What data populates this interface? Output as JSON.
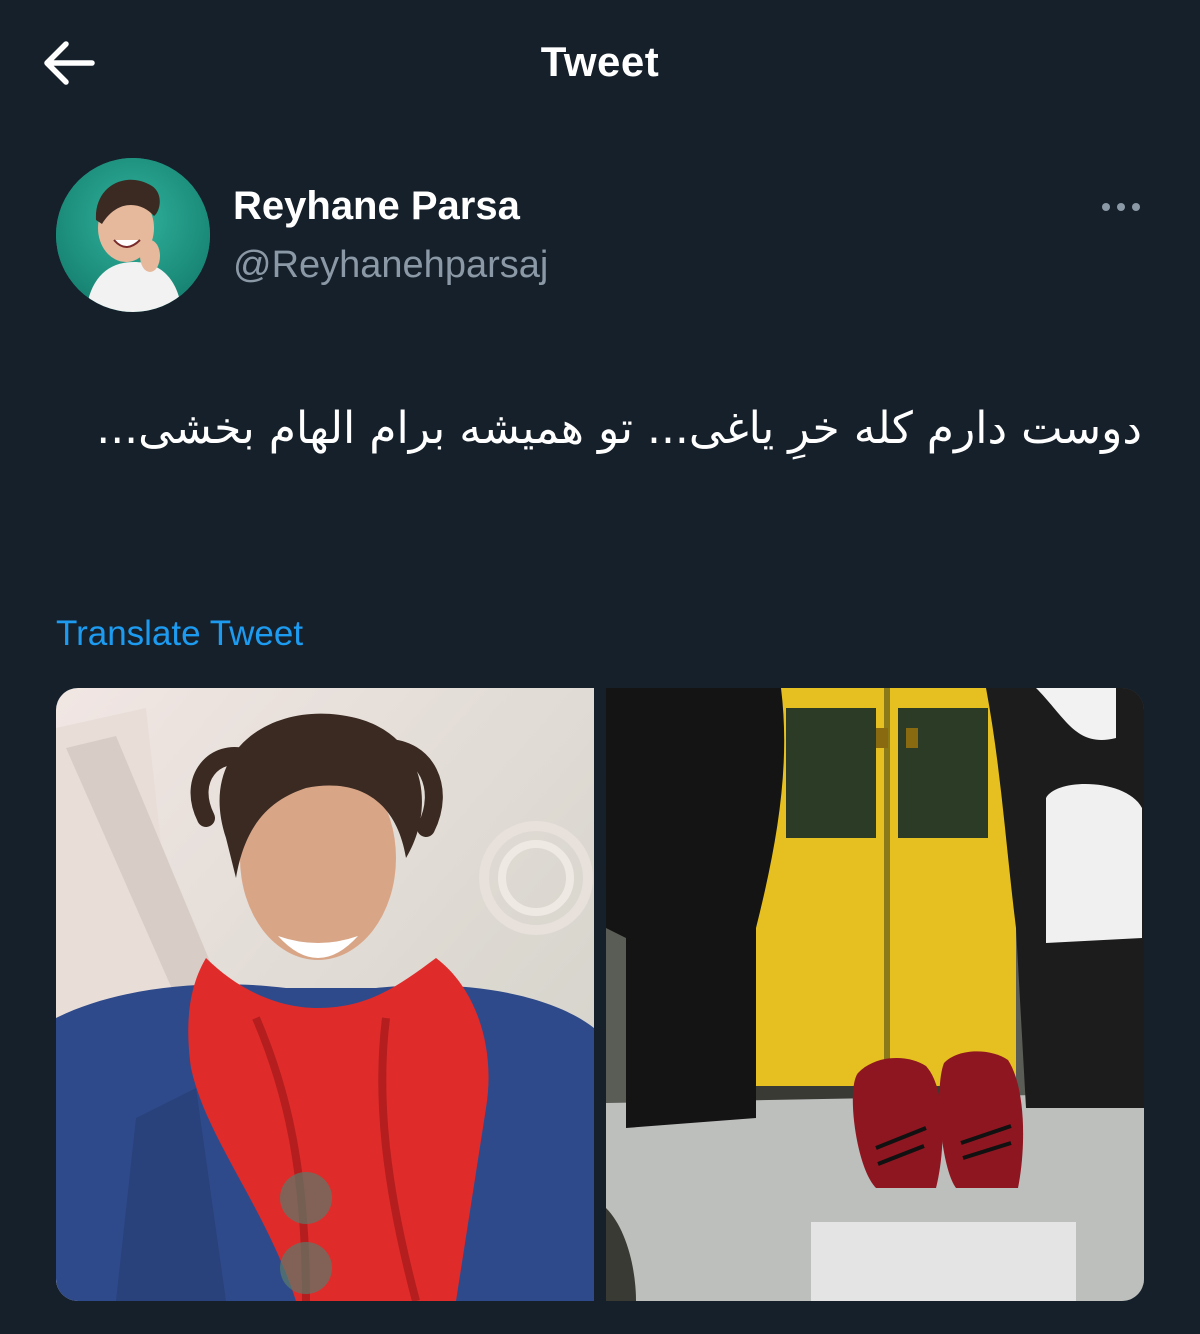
{
  "header": {
    "title": "Tweet",
    "back_icon": "arrow-left-icon"
  },
  "tweet": {
    "author": {
      "display_name": "Reyhane Parsa",
      "handle": "@Reyhanehparsaj"
    },
    "more_icon": "more-horizontal-icon",
    "text": "دوست دارم کله خرِ یاغی... تو همیشه برام الهام بخشی...",
    "translate_label": "Translate Tweet",
    "media": [
      {
        "icon": "photo-icon"
      },
      {
        "icon": "photo-icon"
      }
    ]
  },
  "colors": {
    "background": "#15202b",
    "text_primary": "#ffffff",
    "text_secondary": "#8b98a5",
    "accent": "#1d9bf0"
  }
}
